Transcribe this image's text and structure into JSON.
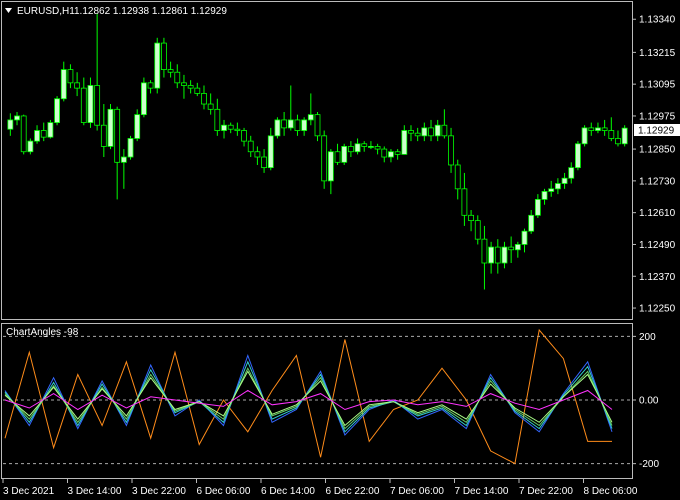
{
  "header": {
    "dropdown_icon": "triangle-down-icon",
    "symbol": "EURUSD,H1",
    "ohlc": "1.12862 1.12938 1.12861 1.12929"
  },
  "price_axis": {
    "labels": [
      "1.13340",
      "1.13215",
      "1.13095",
      "1.12975",
      "1.12850",
      "1.12730",
      "1.12610",
      "1.12490",
      "1.12370",
      "1.12250"
    ],
    "current_price": "1.12929"
  },
  "indicator": {
    "name": "ChartAngles -98",
    "levels": [
      "200",
      "0.00",
      "-200"
    ]
  },
  "time_axis": {
    "labels": [
      "3 Dec 2021",
      "3 Dec 14:00",
      "3 Dec 22:00",
      "6 Dec 06:00",
      "6 Dec 14:00",
      "6 Dec 22:00",
      "7 Dec 06:00",
      "7 Dec 14:00",
      "7 Dec 22:00",
      "8 Dec 06:00"
    ]
  },
  "colors": {
    "background": "#000000",
    "bull_candle": "#ccffcc",
    "bear_candle": "#000000",
    "wick": "#00ff00",
    "line_orange": "#ff8c1a",
    "line_blue": "#3366ff",
    "line_cyan": "#33cccc",
    "line_green": "#66cc66",
    "line_lightgreen": "#aaff88",
    "line_magenta": "#ff33ff",
    "line_white": "#dddddd"
  },
  "chart_data": {
    "type": "candlestick",
    "symbol": "EURUSD",
    "timeframe": "H1",
    "ylim": [
      1.1222,
      1.1339
    ],
    "candles": [
      [
        1.12925,
        1.12985,
        1.129,
        1.1296
      ],
      [
        1.1296,
        1.1299,
        1.1294,
        1.12975
      ],
      [
        1.12975,
        1.1298,
        1.1283,
        1.1284
      ],
      [
        1.1284,
        1.1289,
        1.1283,
        1.1288
      ],
      [
        1.1288,
        1.1294,
        1.1287,
        1.1292
      ],
      [
        1.1292,
        1.1295,
        1.1288,
        1.12895
      ],
      [
        1.12895,
        1.1296,
        1.1289,
        1.1295
      ],
      [
        1.1295,
        1.1305,
        1.1294,
        1.1304
      ],
      [
        1.1304,
        1.1318,
        1.1303,
        1.1315
      ],
      [
        1.1315,
        1.1317,
        1.1308,
        1.131
      ],
      [
        1.131,
        1.1314,
        1.1305,
        1.1308
      ],
      [
        1.1308,
        1.1312,
        1.1294,
        1.1295
      ],
      [
        1.1295,
        1.1312,
        1.1293,
        1.1309
      ],
      [
        1.1309,
        1.1336,
        1.1292,
        1.1294
      ],
      [
        1.1294,
        1.1302,
        1.1282,
        1.1286
      ],
      [
        1.1286,
        1.1302,
        1.1285,
        1.13
      ],
      [
        1.13,
        1.1301,
        1.1266,
        1.128
      ],
      [
        1.128,
        1.1285,
        1.127,
        1.1282
      ],
      [
        1.1282,
        1.129,
        1.1281,
        1.1289
      ],
      [
        1.1289,
        1.13,
        1.1288,
        1.1298
      ],
      [
        1.1298,
        1.1312,
        1.1297,
        1.131
      ],
      [
        1.131,
        1.1311,
        1.1306,
        1.1308
      ],
      [
        1.1308,
        1.1327,
        1.1306,
        1.1325
      ],
      [
        1.1325,
        1.1327,
        1.1312,
        1.1315
      ],
      [
        1.1315,
        1.1318,
        1.1312,
        1.1314
      ],
      [
        1.1314,
        1.1317,
        1.1308,
        1.131
      ],
      [
        1.131,
        1.1313,
        1.1304,
        1.1309
      ],
      [
        1.1309,
        1.1311,
        1.1306,
        1.1308
      ],
      [
        1.1308,
        1.131,
        1.1305,
        1.1306
      ],
      [
        1.1306,
        1.1309,
        1.13,
        1.1302
      ],
      [
        1.1302,
        1.1306,
        1.1298,
        1.13
      ],
      [
        1.13,
        1.1304,
        1.129,
        1.1292
      ],
      [
        1.1292,
        1.1296,
        1.1289,
        1.1294
      ],
      [
        1.1294,
        1.1295,
        1.1291,
        1.12925
      ],
      [
        1.12925,
        1.1295,
        1.129,
        1.1292
      ],
      [
        1.1292,
        1.1293,
        1.1286,
        1.1288
      ],
      [
        1.1288,
        1.129,
        1.1282,
        1.1284
      ],
      [
        1.1284,
        1.1286,
        1.1279,
        1.1282
      ],
      [
        1.1282,
        1.1285,
        1.1276,
        1.1278
      ],
      [
        1.1278,
        1.1293,
        1.1277,
        1.129
      ],
      [
        1.129,
        1.1297,
        1.1289,
        1.1296
      ],
      [
        1.1296,
        1.1299,
        1.129,
        1.1293
      ],
      [
        1.1293,
        1.1309,
        1.1292,
        1.1296
      ],
      [
        1.1296,
        1.1298,
        1.129,
        1.1292
      ],
      [
        1.1292,
        1.1297,
        1.129,
        1.1296
      ],
      [
        1.1296,
        1.1306,
        1.1294,
        1.1298
      ],
      [
        1.1298,
        1.1299,
        1.1288,
        1.129
      ],
      [
        1.129,
        1.1292,
        1.127,
        1.1273
      ],
      [
        1.1273,
        1.1285,
        1.1268,
        1.1284
      ],
      [
        1.1284,
        1.1287,
        1.1279,
        1.128
      ],
      [
        1.128,
        1.1287,
        1.1279,
        1.1286
      ],
      [
        1.1286,
        1.1288,
        1.1282,
        1.1284
      ],
      [
        1.1284,
        1.1289,
        1.1283,
        1.1287
      ],
      [
        1.1287,
        1.1288,
        1.1284,
        1.1286
      ],
      [
        1.1286,
        1.1288,
        1.1285,
        1.1286
      ],
      [
        1.1286,
        1.1287,
        1.1283,
        1.1285
      ],
      [
        1.1285,
        1.1286,
        1.128,
        1.1282
      ],
      [
        1.1282,
        1.1285,
        1.128,
        1.1284
      ],
      [
        1.1284,
        1.1285,
        1.1281,
        1.1283
      ],
      [
        1.1283,
        1.1294,
        1.1283,
        1.1292
      ],
      [
        1.1292,
        1.1294,
        1.1288,
        1.1291
      ],
      [
        1.1291,
        1.1293,
        1.1288,
        1.129
      ],
      [
        1.129,
        1.1295,
        1.1288,
        1.1293
      ],
      [
        1.1293,
        1.1296,
        1.1288,
        1.129
      ],
      [
        1.129,
        1.1296,
        1.1288,
        1.1294
      ],
      [
        1.1294,
        1.13,
        1.1289,
        1.129
      ],
      [
        1.129,
        1.1293,
        1.1276,
        1.1279
      ],
      [
        1.1279,
        1.1281,
        1.1266,
        1.127
      ],
      [
        1.127,
        1.1276,
        1.1256,
        1.126
      ],
      [
        1.126,
        1.1262,
        1.1254,
        1.1258
      ],
      [
        1.1258,
        1.126,
        1.1249,
        1.1251
      ],
      [
        1.1251,
        1.1256,
        1.1232,
        1.1242
      ],
      [
        1.1242,
        1.125,
        1.1238,
        1.1248
      ],
      [
        1.1248,
        1.1251,
        1.1238,
        1.1242
      ],
      [
        1.1242,
        1.125,
        1.124,
        1.1248
      ],
      [
        1.1248,
        1.1252,
        1.1242,
        1.1247
      ],
      [
        1.1247,
        1.125,
        1.1244,
        1.1249
      ],
      [
        1.1249,
        1.1255,
        1.1246,
        1.1254
      ],
      [
        1.1254,
        1.1262,
        1.1253,
        1.126
      ],
      [
        1.126,
        1.1268,
        1.1259,
        1.1266
      ],
      [
        1.1266,
        1.127,
        1.1264,
        1.1269
      ],
      [
        1.1269,
        1.1273,
        1.1267,
        1.127
      ],
      [
        1.127,
        1.1274,
        1.1268,
        1.1272
      ],
      [
        1.1272,
        1.1276,
        1.127,
        1.1274
      ],
      [
        1.1274,
        1.128,
        1.1272,
        1.1278
      ],
      [
        1.1278,
        1.1288,
        1.1277,
        1.1287
      ],
      [
        1.1287,
        1.1294,
        1.1286,
        1.1293
      ],
      [
        1.1293,
        1.1295,
        1.129,
        1.1292
      ],
      [
        1.1292,
        1.1295,
        1.1291,
        1.1293
      ],
      [
        1.1293,
        1.1296,
        1.129,
        1.1292
      ],
      [
        1.1292,
        1.1297,
        1.1288,
        1.1289
      ],
      [
        1.1289,
        1.1292,
        1.1286,
        1.1287
      ],
      [
        1.1287,
        1.1294,
        1.1286,
        1.12929
      ]
    ],
    "indicator": {
      "name": "ChartAngles -98",
      "ylim": [
        -220,
        220
      ],
      "levels": [
        200,
        0,
        -200
      ],
      "series": [
        {
          "color": "#ff8c1a",
          "values": [
            -120,
            150,
            -150,
            80,
            -80,
            120,
            -120,
            150,
            -140,
            0,
            -100,
            30,
            140,
            -180,
            190,
            -130,
            -30,
            0,
            100,
            0,
            -160,
            -200,
            220,
            130,
            -130,
            -130
          ]
        },
        {
          "color": "#3366ff",
          "values": [
            30,
            -80,
            70,
            -90,
            60,
            -80,
            110,
            -50,
            0,
            -80,
            140,
            -70,
            -30,
            90,
            -110,
            -30,
            0,
            -60,
            -30,
            -90,
            80,
            -40,
            -100,
            20,
            120,
            -100
          ]
        },
        {
          "color": "#33cccc",
          "values": [
            25,
            -70,
            55,
            -80,
            50,
            -70,
            95,
            -40,
            -5,
            -70,
            120,
            -60,
            -25,
            80,
            -100,
            -25,
            -5,
            -50,
            -25,
            -80,
            70,
            -35,
            -90,
            15,
            105,
            -90
          ]
        },
        {
          "color": "#66cc66",
          "values": [
            20,
            -60,
            45,
            -70,
            40,
            -60,
            80,
            -35,
            -5,
            -60,
            100,
            -50,
            -20,
            70,
            -90,
            -20,
            -5,
            -45,
            -20,
            -70,
            60,
            -30,
            -80,
            10,
            90,
            -80
          ]
        },
        {
          "color": "#aaff88",
          "values": [
            15,
            -50,
            40,
            -60,
            35,
            -50,
            70,
            -30,
            -5,
            -50,
            90,
            -45,
            -15,
            60,
            -80,
            -15,
            -5,
            -40,
            -15,
            -60,
            50,
            -25,
            -70,
            10,
            80,
            -70
          ]
        },
        {
          "color": "#ff33ff",
          "values": [
            0,
            -25,
            20,
            -30,
            15,
            -25,
            10,
            0,
            -10,
            -20,
            30,
            -15,
            -5,
            20,
            -30,
            -5,
            0,
            -15,
            -5,
            -20,
            20,
            -10,
            -30,
            0,
            30,
            -30
          ]
        }
      ]
    }
  }
}
